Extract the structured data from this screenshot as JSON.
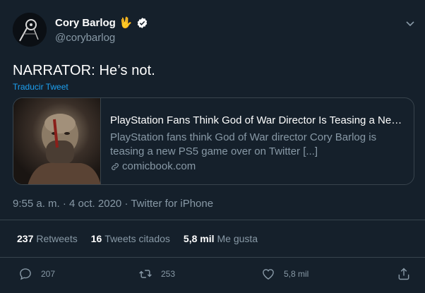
{
  "author": {
    "display_name": "Cory Barlog",
    "name_emoji": "🖖",
    "handle": "@corybarlog"
  },
  "tweet": {
    "text": "NARRATOR: He’s not.",
    "translate_label": "Traducir Tweet",
    "timestamp": "9:55 a. m. · 4 oct. 2020",
    "separator": "·",
    "source": "Twitter for iPhone"
  },
  "card": {
    "title": "PlayStation Fans Think God of War Director Is Teasing a New P...",
    "description": "PlayStation fans think God of War director Cory Barlog is teasing a new PS5 game over on Twitter [...]",
    "domain": "comicbook.com"
  },
  "stats": {
    "retweets_count": "237",
    "retweets_label": "Retweets",
    "quotes_count": "16",
    "quotes_label": "Tweets citados",
    "likes_count": "5,8 mil",
    "likes_label": "Me gusta"
  },
  "actions": {
    "reply_count": "207",
    "retweet_count": "253",
    "like_count": "5,8 mil"
  },
  "colors": {
    "background": "#15202b",
    "border": "#38444d",
    "secondary_text": "#8899a6",
    "link": "#1da1f2"
  },
  "icons": [
    "avatar-image",
    "vulcan-salute-emoji",
    "verified-badge-icon",
    "chevron-down-icon",
    "link-icon",
    "reply-icon",
    "retweet-icon",
    "like-icon",
    "share-icon"
  ]
}
